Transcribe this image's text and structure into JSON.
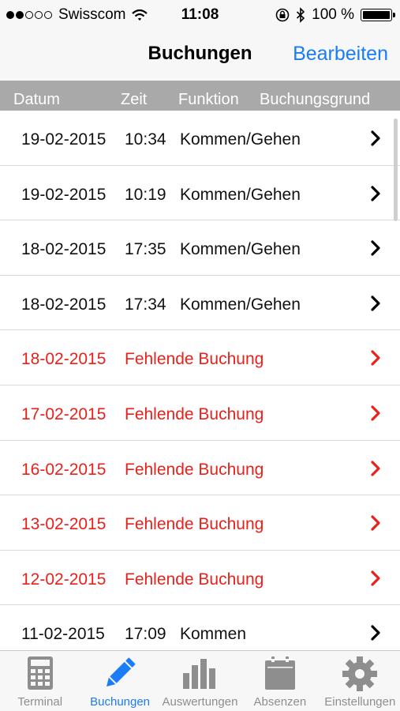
{
  "status_bar": {
    "carrier": "Swisscom",
    "time": "11:08",
    "battery": "100 %",
    "signal_bars_filled": 2,
    "signal_bars_total": 5
  },
  "nav": {
    "title": "Buchungen",
    "edit_label": "Bearbeiten"
  },
  "columns": {
    "date": "Datum",
    "time": "Zeit",
    "function": "Funktion",
    "reason": "Buchungsgrund"
  },
  "rows": [
    {
      "date": "19-02-2015",
      "time": "10:34",
      "function": "Kommen/Gehen"
    },
    {
      "date": "19-02-2015",
      "time": "10:19",
      "function": "Kommen/Gehen"
    },
    {
      "date": "18-02-2015",
      "time": "17:35",
      "function": "Kommen/Gehen"
    },
    {
      "date": "18-02-2015",
      "time": "17:34",
      "function": "Kommen/Gehen"
    },
    {
      "date": "18-02-2015",
      "reason": "Fehlende Buchung"
    },
    {
      "date": "17-02-2015",
      "reason": "Fehlende Buchung"
    },
    {
      "date": "16-02-2015",
      "reason": "Fehlende Buchung"
    },
    {
      "date": "13-02-2015",
      "reason": "Fehlende Buchung"
    },
    {
      "date": "12-02-2015",
      "reason": "Fehlende Buchung"
    },
    {
      "date": "11-02-2015",
      "time": "17:09",
      "function": "Kommen"
    }
  ],
  "tabs": [
    {
      "label": "Terminal",
      "icon": "calculator-icon"
    },
    {
      "label": "Buchungen",
      "icon": "pencil-icon",
      "active": true
    },
    {
      "label": "Auswertungen",
      "icon": "bar-chart-icon"
    },
    {
      "label": "Absenzen",
      "icon": "calendar-icon"
    },
    {
      "label": "Einstellungen",
      "icon": "gear-icon"
    }
  ],
  "colors": {
    "accent": "#1a7cf6",
    "missing": "#e8211b",
    "header_bg": "#a9a9a9"
  }
}
